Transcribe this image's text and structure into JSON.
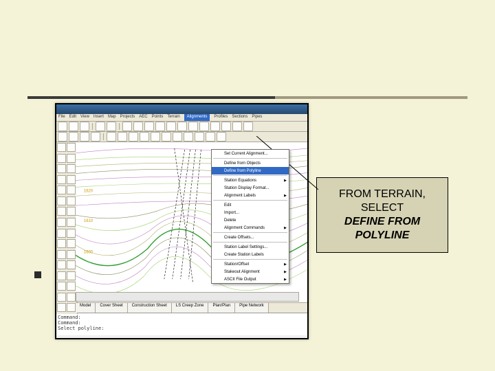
{
  "slide": {
    "callout_line1": "FROM TERRAIN,",
    "callout_line2": "SELECT",
    "callout_line3": "DEFINE FROM",
    "callout_line4": "POLYLINE"
  },
  "menubar": [
    "File",
    "Edit",
    "View",
    "Insert",
    "Map",
    "Projects",
    "AEC",
    "Points",
    "Terrain",
    "Alignments",
    "Profiles",
    "Sections",
    "Pipes"
  ],
  "open_menu_label": "Alignments",
  "dropdown": {
    "items": [
      {
        "label": "Set Current Alignment...",
        "sep_after": true
      },
      {
        "label": "Define from Objects"
      },
      {
        "label": "Define from Polyline",
        "selected": true,
        "sep_after": true
      },
      {
        "label": "Station Equations",
        "arrow": true
      },
      {
        "label": "Station Display Format..."
      },
      {
        "label": "Alignment Labels",
        "arrow": true,
        "sep_after": true
      },
      {
        "label": "Edit"
      },
      {
        "label": "Import..."
      },
      {
        "label": "Delete"
      },
      {
        "label": "Alignment Commands",
        "arrow": true,
        "sep_after": true
      },
      {
        "label": "Create Offsets...",
        "sep_after": true
      },
      {
        "label": "Station Label Settings..."
      },
      {
        "label": "Create Station Labels",
        "sep_after": true
      },
      {
        "label": "Station/Offset",
        "arrow": true
      },
      {
        "label": "Stakeout Alignment",
        "arrow": true
      },
      {
        "label": "ASCII File Output",
        "arrow": true
      }
    ]
  },
  "tabs": [
    "Model",
    "Cover Sheet",
    "Construction Sheet",
    "LS Creep Zone",
    "Plan/Plan",
    "Pipe Network"
  ],
  "command": {
    "l1": "Command:",
    "l2": "Command:",
    "l3": "Select polyline:"
  }
}
